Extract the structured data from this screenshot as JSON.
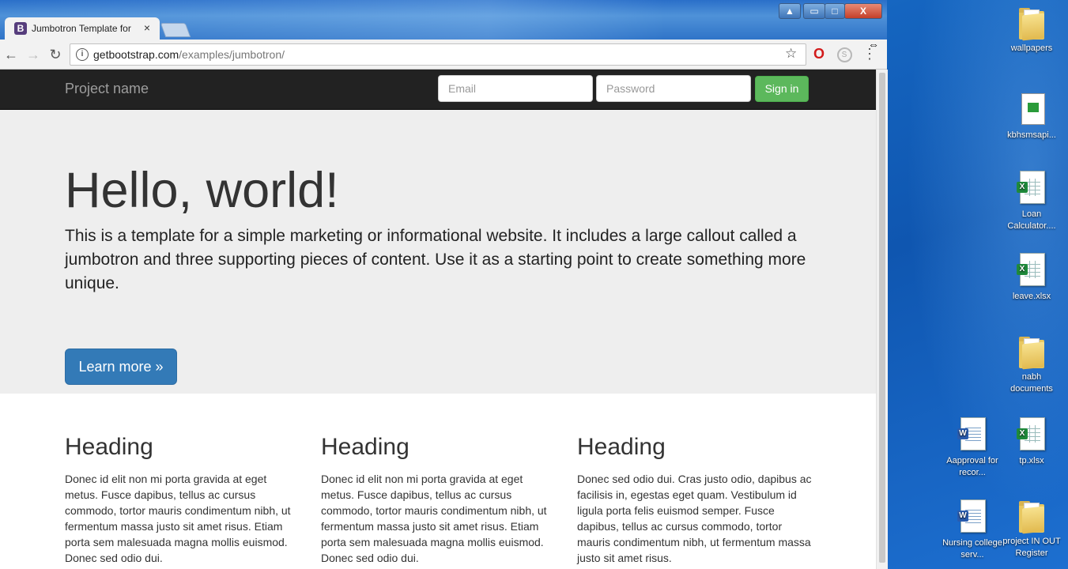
{
  "browser": {
    "tab_title": "Jumbotron Template for",
    "tab_favicon_letter": "B",
    "tab_close": "×",
    "url_host": "getbootstrap.com",
    "url_path": "/examples/jumbotron/",
    "info_glyph": "i",
    "star_glyph": "☆",
    "back_glyph": "←",
    "forward_glyph": "→",
    "reload_glyph": "↻",
    "menu_glyph": "⋮",
    "opera_glyph": "O",
    "skype_glyph": "S",
    "win_user": "▲",
    "win_min": "▭",
    "win_max": "□",
    "win_close": "X"
  },
  "page": {
    "navbar": {
      "brand": "Project name",
      "email_placeholder": "Email",
      "password_placeholder": "Password",
      "signin_label": "Sign in"
    },
    "jumbotron": {
      "heading": "Hello, world!",
      "text": "This is a template for a simple marketing or informational website. It includes a large callout called a jumbotron and three supporting pieces of content. Use it as a starting point to create something more unique.",
      "button_label": "Learn more »"
    },
    "columns": [
      {
        "heading": "Heading",
        "text": "Donec id elit non mi porta gravida at eget metus. Fusce dapibus, tellus ac cursus commodo, tortor mauris condimentum nibh, ut fermentum massa justo sit amet risus. Etiam porta sem malesuada magna mollis euismod. Donec sed odio dui."
      },
      {
        "heading": "Heading",
        "text": "Donec id elit non mi porta gravida at eget metus. Fusce dapibus, tellus ac cursus commodo, tortor mauris condimentum nibh, ut fermentum massa justo sit amet risus. Etiam porta sem malesuada magna mollis euismod. Donec sed odio dui."
      },
      {
        "heading": "Heading",
        "text": "Donec sed odio dui. Cras justo odio, dapibus ac facilisis in, egestas eget quam. Vestibulum id ligula porta felis euismod semper. Fusce dapibus, tellus ac cursus commodo, tortor mauris condimentum nibh, ut fermentum massa justo sit amet risus."
      }
    ]
  },
  "desktop": {
    "icons": [
      {
        "label": "wallpapers",
        "icon": "folder-icon"
      },
      {
        "label": "kbhsmsapi...",
        "icon": "notepad-file-icon"
      },
      {
        "label": "Loan Calculator....",
        "icon": "excel-file-icon"
      },
      {
        "label": "leave.xlsx",
        "icon": "excel-file-icon"
      },
      {
        "label": "nabh documents",
        "icon": "folder-icon"
      },
      {
        "label": "Aapproval for recor...",
        "icon": "word-file-icon"
      },
      {
        "label": "tp.xlsx",
        "icon": "excel-file-icon"
      },
      {
        "label": "Nursing college serv...",
        "icon": "word-file-icon"
      },
      {
        "label": "project IN OUT Register",
        "icon": "folder-icon"
      }
    ],
    "excel_badge": "X",
    "word_badge": "W"
  },
  "colors": {
    "navbar_bg": "#222222",
    "jumbotron_bg": "#eeeeee",
    "primary": "#337ab7",
    "success": "#5cb85c"
  }
}
